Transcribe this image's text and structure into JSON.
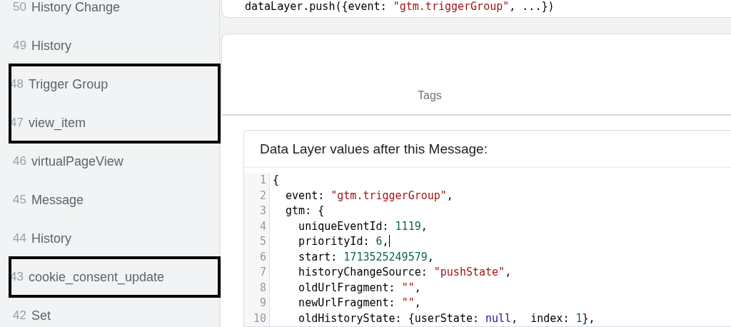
{
  "sidebar": {
    "items": [
      {
        "number": "50",
        "label": "History Change",
        "outlined": false
      },
      {
        "number": "49",
        "label": "History",
        "outlined": false
      },
      {
        "number": "48",
        "label": "Trigger Group",
        "outlined": true
      },
      {
        "number": "47",
        "label": "view_item",
        "outlined": true
      },
      {
        "number": "46",
        "label": "virtualPageView",
        "outlined": false
      },
      {
        "number": "45",
        "label": "Message",
        "outlined": false
      },
      {
        "number": "44",
        "label": "History",
        "outlined": false
      },
      {
        "number": "43",
        "label": "cookie_consent_update",
        "outlined": true
      },
      {
        "number": "42",
        "label": "Set",
        "outlined": false
      }
    ]
  },
  "message_card": {
    "code": [
      {
        "kind": "plain",
        "text": "dataLayer.push({event: "
      },
      {
        "kind": "string",
        "text": "\"gtm.triggerGroup\""
      },
      {
        "kind": "plain",
        "text": ", ...})"
      }
    ]
  },
  "tags_panel": {
    "tab": "Tags"
  },
  "data_layer": {
    "title": "Data Layer values after this Message:",
    "lines": [
      {
        "number": "1",
        "cursor": false,
        "tokens": [
          {
            "kind": "plain",
            "text": "{"
          }
        ]
      },
      {
        "number": "2",
        "cursor": false,
        "tokens": [
          {
            "kind": "plain",
            "text": "  event: "
          },
          {
            "kind": "string",
            "text": "\"gtm.triggerGroup\""
          },
          {
            "kind": "plain",
            "text": ","
          }
        ]
      },
      {
        "number": "3",
        "cursor": false,
        "tokens": [
          {
            "kind": "plain",
            "text": "  gtm: {"
          }
        ]
      },
      {
        "number": "4",
        "cursor": false,
        "tokens": [
          {
            "kind": "plain",
            "text": "    uniqueEventId: "
          },
          {
            "kind": "number",
            "text": "1119"
          },
          {
            "kind": "plain",
            "text": ","
          }
        ]
      },
      {
        "number": "5",
        "cursor": true,
        "tokens": [
          {
            "kind": "plain",
            "text": "    priorityId: "
          },
          {
            "kind": "number",
            "text": "6"
          },
          {
            "kind": "plain",
            "text": ","
          }
        ]
      },
      {
        "number": "6",
        "cursor": false,
        "tokens": [
          {
            "kind": "plain",
            "text": "    start: "
          },
          {
            "kind": "number",
            "text": "1713525249579"
          },
          {
            "kind": "plain",
            "text": ","
          }
        ]
      },
      {
        "number": "7",
        "cursor": false,
        "tokens": [
          {
            "kind": "plain",
            "text": "    historyChangeSource: "
          },
          {
            "kind": "string",
            "text": "\"pushState\""
          },
          {
            "kind": "plain",
            "text": ","
          }
        ]
      },
      {
        "number": "8",
        "cursor": false,
        "tokens": [
          {
            "kind": "plain",
            "text": "    oldUrlFragment: "
          },
          {
            "kind": "string",
            "text": "\"\""
          },
          {
            "kind": "plain",
            "text": ","
          }
        ]
      },
      {
        "number": "9",
        "cursor": false,
        "tokens": [
          {
            "kind": "plain",
            "text": "    newUrlFragment: "
          },
          {
            "kind": "string",
            "text": "\"\""
          },
          {
            "kind": "plain",
            "text": ","
          }
        ]
      },
      {
        "number": "10",
        "cursor": false,
        "tokens": [
          {
            "kind": "plain",
            "text": "    oldHistoryState: {userState: "
          },
          {
            "kind": "keyword",
            "text": "null"
          },
          {
            "kind": "plain",
            "text": ",  index: "
          },
          {
            "kind": "number",
            "text": "1"
          },
          {
            "kind": "plain",
            "text": "},"
          }
        ]
      }
    ]
  }
}
